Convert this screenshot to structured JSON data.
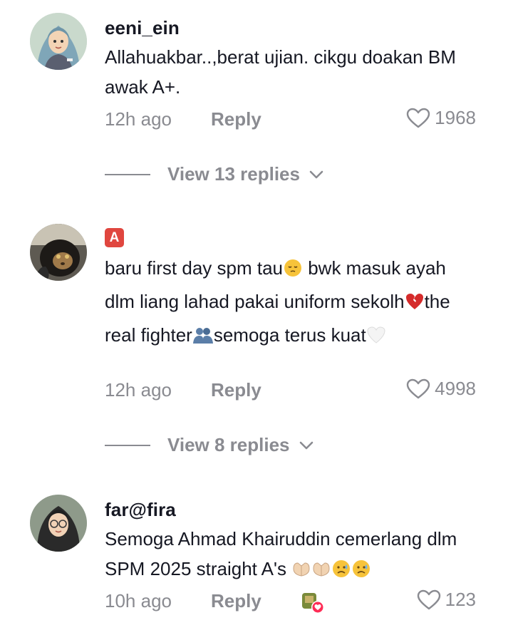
{
  "comments": [
    {
      "username": "eeni_ein",
      "text": "Allahuakbar..,berat ujian. cikgu doakan BM awak A+.",
      "time": "12h ago",
      "reply": "Reply",
      "likes": "1968",
      "view_replies": "View 13 replies"
    },
    {
      "username": "",
      "badge": "A",
      "text_parts": [
        "baru first day spm tau",
        " bwk masuk ayah dlm liang lahad pakai uniform sekolh",
        "the real fighter",
        "semoga terus kuat"
      ],
      "time": "12h ago",
      "reply": "Reply",
      "likes": "4998",
      "view_replies": "View 8 replies"
    },
    {
      "username": "far@fira",
      "text": "Semoga Ahmad Khairuddin cemerlang dlm SPM 2025 straight A's",
      "time": "10h ago",
      "reply": "Reply",
      "likes": "123"
    }
  ],
  "icons": {
    "heart": "heart-outline-icon",
    "chevron": "chevron-down-icon",
    "creator_liked": "creator-liked-badge-icon"
  },
  "colors": {
    "text": "#161823",
    "muted": "#8a8b91",
    "badge": "#e0463f",
    "liked": "#fe2c55"
  }
}
